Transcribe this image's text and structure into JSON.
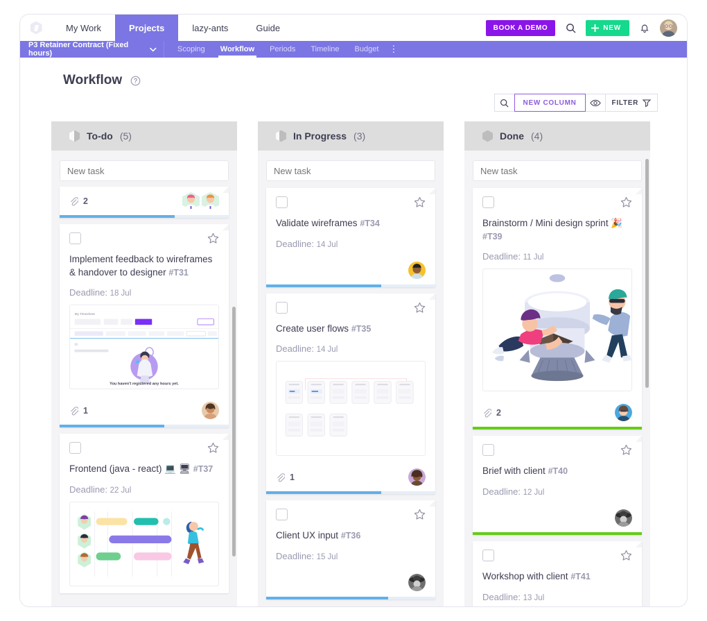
{
  "topnav": {
    "logo": "app-logo",
    "tabs": [
      {
        "label": "My Work",
        "active": false
      },
      {
        "label": "Projects",
        "active": true
      },
      {
        "label": "lazy-ants",
        "active": false
      },
      {
        "label": "Guide",
        "active": false
      }
    ],
    "book_demo_label": "BOOK A DEMO",
    "search_icon": "search-icon",
    "new_label": "NEW",
    "bell_icon": "bell-icon",
    "avatar": "user-avatar"
  },
  "projectbar": {
    "project_name": "P3 Retainer Contract (Fixed hours)",
    "tabs": [
      {
        "label": "Scoping",
        "active": false
      },
      {
        "label": "Workflow",
        "active": true
      },
      {
        "label": "Periods",
        "active": false
      },
      {
        "label": "Timeline",
        "active": false
      },
      {
        "label": "Budget",
        "active": false
      }
    ],
    "more_label": "⋮"
  },
  "page": {
    "title": "Workflow",
    "help_icon": "help-circle-icon"
  },
  "toolbar": {
    "search_icon": "search-icon",
    "new_column_label": "NEW COLUMN",
    "eye_icon": "eye-icon",
    "filter_label": "FILTER",
    "accent_purple": "#8c5ce0"
  },
  "board": {
    "new_task_placeholder": "New task",
    "columns": [
      {
        "title": "To-do",
        "count": "(5)",
        "icon_fill_pct": 45,
        "cards": [
          {
            "partial_top": true,
            "attachments": "2",
            "avatars": [
              "avatar-pink-hex",
              "avatar-orange-hex"
            ],
            "progress_pct": 68,
            "progress_color": "#62b0e8"
          },
          {
            "title": "Implement feedback to wireframes & handover to designer",
            "task_id": "#T31",
            "deadline_label": "Deadline:",
            "deadline_value": "18 Jul",
            "thumb": "timesheet-screenshot",
            "attachments": "1",
            "avatars": [
              "avatar-curly-woman"
            ],
            "progress_pct": 62,
            "progress_color": "#62b0e8"
          },
          {
            "title": "Frontend (java - react) 💻 🖥",
            "task_id": "#T37",
            "deadline_label": "Deadline:",
            "deadline_value": "22 Jul",
            "thumb": "gantt-illustration"
          }
        ]
      },
      {
        "title": "In Progress",
        "count": "(3)",
        "icon_fill_pct": 30,
        "cards": [
          {
            "title": "Validate wireframes",
            "task_id": "#T34",
            "deadline_label": "Deadline:",
            "deadline_value": "14 Jul",
            "avatars": [
              "avatar-yellow-man"
            ],
            "progress_pct": 68,
            "progress_color": "#62b0e8"
          },
          {
            "title": "Create user flows",
            "task_id": "#T35",
            "deadline_label": "Deadline:",
            "deadline_value": "14 Jul",
            "thumb": "userflow-screens",
            "attachments": "1",
            "avatars": [
              "avatar-curly-woman"
            ],
            "progress_pct": 68,
            "progress_color": "#62b0e8"
          },
          {
            "title": "Client UX input",
            "task_id": "#T36",
            "deadline_label": "Deadline:",
            "deadline_value": "15 Jul",
            "avatars": [
              "avatar-hat-person"
            ],
            "progress_pct": 72,
            "progress_color": "#62b0e8"
          }
        ]
      },
      {
        "title": "Done",
        "count": "(4)",
        "icon_fill_pct": 0,
        "cards": [
          {
            "title": "Brainstorm / Mini design sprint 🎉",
            "task_id": "#T39",
            "deadline_label": "Deadline:",
            "deadline_value": "11 Jul",
            "thumb": "rocket-illustration",
            "attachments": "2",
            "avatars": [
              "avatar-glasses-woman"
            ],
            "progress_pct": 100,
            "progress_color": "#66cc17"
          },
          {
            "title": "Brief with client",
            "task_id": "#T40",
            "deadline_label": "Deadline:",
            "deadline_value": "12 Jul",
            "avatars": [
              "avatar-hat-person"
            ],
            "progress_pct": 100,
            "progress_color": "#66cc17"
          },
          {
            "title": "Workshop with client",
            "task_id": "#T41",
            "deadline_label": "Deadline:",
            "deadline_value": "13 Jul"
          }
        ]
      }
    ]
  }
}
